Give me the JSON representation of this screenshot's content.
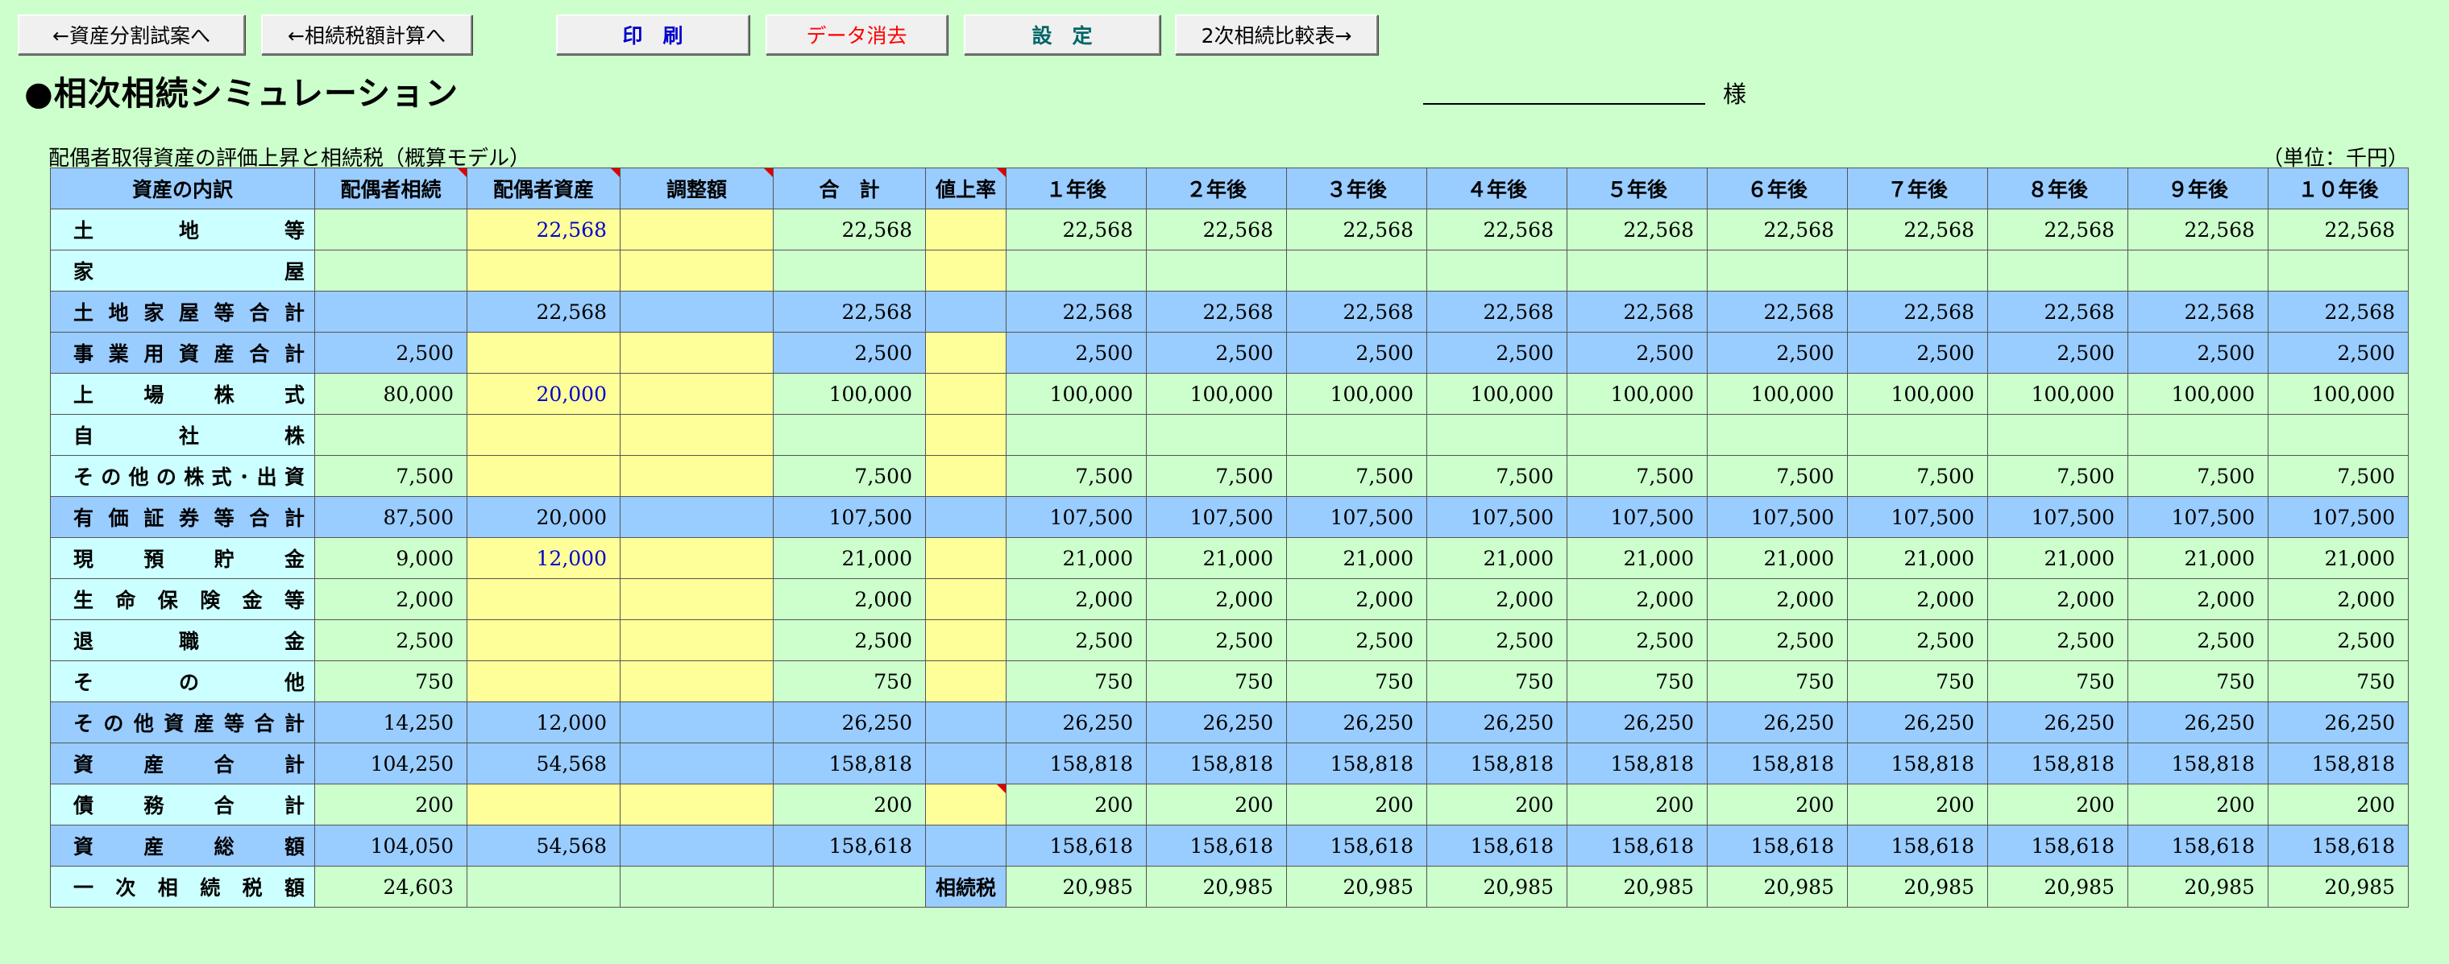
{
  "toolbar": {
    "asset_split_label": "←資産分割試案へ",
    "tax_calc_label": "←相続税額計算へ",
    "print_label": "印　刷",
    "clear_label": "データ消去",
    "settings_label": "設　定",
    "second_compare_label": "2次相続比較表→",
    "clear_color": "#ff0000",
    "print_color": "#0000cc",
    "settings_color": "#006666"
  },
  "header": {
    "title": "●相次相続シミュレーション",
    "honorific": "様",
    "subtitle": "配偶者取得資産の評価上昇と相続税（概算モデル）",
    "unit": "（単位：千円）"
  },
  "table": {
    "columns": [
      "資産の内訳",
      "配偶者相続",
      "配偶者資産",
      "調整額",
      "合　計",
      "値上率",
      "１年後",
      "２年後",
      "３年後",
      "４年後",
      "５年後",
      "６年後",
      "７年後",
      "８年後",
      "９年後",
      "１０年後"
    ],
    "rows": [
      {
        "label": "土地等",
        "values": [
          "",
          "22,568",
          "",
          "22,568",
          "",
          "22,568",
          "22,568",
          "22,568",
          "22,568",
          "22,568",
          "22,568",
          "22,568",
          "22,568",
          "22,568",
          "22,568"
        ]
      },
      {
        "label": "家屋",
        "values": [
          "",
          "",
          "",
          "",
          "",
          "",
          "",
          "",
          "",
          "",
          "",
          "",
          "",
          "",
          ""
        ]
      },
      {
        "label": "土地家屋等合計",
        "values": [
          "",
          "22,568",
          "",
          "22,568",
          "",
          "22,568",
          "22,568",
          "22,568",
          "22,568",
          "22,568",
          "22,568",
          "22,568",
          "22,568",
          "22,568",
          "22,568"
        ]
      },
      {
        "label": "事業用資産合計",
        "values": [
          "2,500",
          "",
          "",
          "2,500",
          "",
          "2,500",
          "2,500",
          "2,500",
          "2,500",
          "2,500",
          "2,500",
          "2,500",
          "2,500",
          "2,500",
          "2,500"
        ]
      },
      {
        "label": "上場株式",
        "values": [
          "80,000",
          "20,000",
          "",
          "100,000",
          "",
          "100,000",
          "100,000",
          "100,000",
          "100,000",
          "100,000",
          "100,000",
          "100,000",
          "100,000",
          "100,000",
          "100,000"
        ]
      },
      {
        "label": "自社株",
        "values": [
          "",
          "",
          "",
          "",
          "",
          "",
          "",
          "",
          "",
          "",
          "",
          "",
          "",
          "",
          ""
        ]
      },
      {
        "label": "その他の株式･出資",
        "values": [
          "7,500",
          "",
          "",
          "7,500",
          "",
          "7,500",
          "7,500",
          "7,500",
          "7,500",
          "7,500",
          "7,500",
          "7,500",
          "7,500",
          "7,500",
          "7,500"
        ]
      },
      {
        "label": "有価証券等合計",
        "values": [
          "87,500",
          "20,000",
          "",
          "107,500",
          "",
          "107,500",
          "107,500",
          "107,500",
          "107,500",
          "107,500",
          "107,500",
          "107,500",
          "107,500",
          "107,500",
          "107,500"
        ]
      },
      {
        "label": "現預貯金",
        "values": [
          "9,000",
          "12,000",
          "",
          "21,000",
          "",
          "21,000",
          "21,000",
          "21,000",
          "21,000",
          "21,000",
          "21,000",
          "21,000",
          "21,000",
          "21,000",
          "21,000"
        ]
      },
      {
        "label": "生命保険金等",
        "values": [
          "2,000",
          "",
          "",
          "2,000",
          "",
          "2,000",
          "2,000",
          "2,000",
          "2,000",
          "2,000",
          "2,000",
          "2,000",
          "2,000",
          "2,000",
          "2,000"
        ]
      },
      {
        "label": "退職金",
        "values": [
          "2,500",
          "",
          "",
          "2,500",
          "",
          "2,500",
          "2,500",
          "2,500",
          "2,500",
          "2,500",
          "2,500",
          "2,500",
          "2,500",
          "2,500",
          "2,500"
        ]
      },
      {
        "label": "その他",
        "values": [
          "750",
          "",
          "",
          "750",
          "",
          "750",
          "750",
          "750",
          "750",
          "750",
          "750",
          "750",
          "750",
          "750",
          "750"
        ]
      },
      {
        "label": "その他資産等合計",
        "values": [
          "14,250",
          "12,000",
          "",
          "26,250",
          "",
          "26,250",
          "26,250",
          "26,250",
          "26,250",
          "26,250",
          "26,250",
          "26,250",
          "26,250",
          "26,250",
          "26,250"
        ]
      },
      {
        "label": "資産合計",
        "values": [
          "104,250",
          "54,568",
          "",
          "158,818",
          "",
          "158,818",
          "158,818",
          "158,818",
          "158,818",
          "158,818",
          "158,818",
          "158,818",
          "158,818",
          "158,818",
          "158,818"
        ]
      },
      {
        "label": "債務合計",
        "values": [
          "200",
          "",
          "",
          "200",
          "",
          "200",
          "200",
          "200",
          "200",
          "200",
          "200",
          "200",
          "200",
          "200",
          "200"
        ]
      },
      {
        "label": "資産総額",
        "values": [
          "104,050",
          "54,568",
          "",
          "158,618",
          "",
          "158,618",
          "158,618",
          "158,618",
          "158,618",
          "158,618",
          "158,618",
          "158,618",
          "158,618",
          "158,618",
          "158,618"
        ]
      },
      {
        "label": "一次相続税額",
        "values": [
          "24,603",
          "",
          "",
          "",
          "相続税",
          "20,985",
          "20,985",
          "20,985",
          "20,985",
          "20,985",
          "20,985",
          "20,985",
          "20,985",
          "20,985",
          "20,985"
        ]
      }
    ]
  }
}
